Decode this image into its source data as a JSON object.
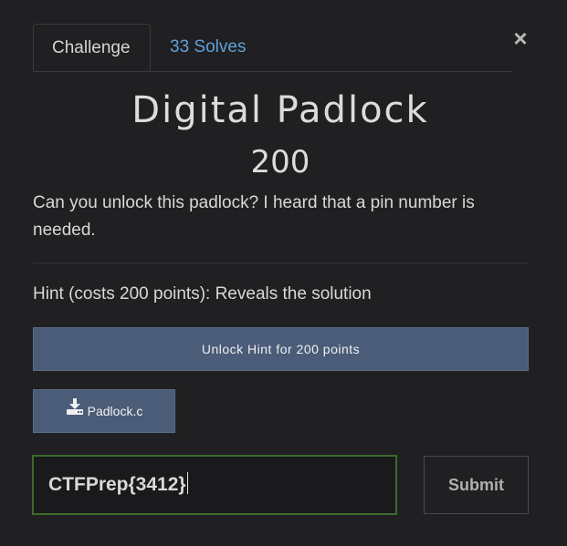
{
  "tabs": {
    "challenge_label": "Challenge",
    "solves_label": "33 Solves"
  },
  "close_symbol": "×",
  "challenge": {
    "name": "Digital Padlock",
    "value": "200",
    "description": "Can you unlock this padlock? I heard that a pin number is needed."
  },
  "hint": {
    "text": "Hint (costs 200 points): Reveals the solution",
    "unlock_label": "Unlock Hint for 200 points"
  },
  "file": {
    "icon": "download-icon",
    "name": "Padlock.c"
  },
  "submission": {
    "input_value": "CTFPrep{3412}",
    "submit_label": "Submit"
  },
  "colors": {
    "background": "#202022",
    "accent_button": "#4a5c78",
    "link": "#5ea0d8",
    "input_border_focus": "#3c6a2c"
  }
}
